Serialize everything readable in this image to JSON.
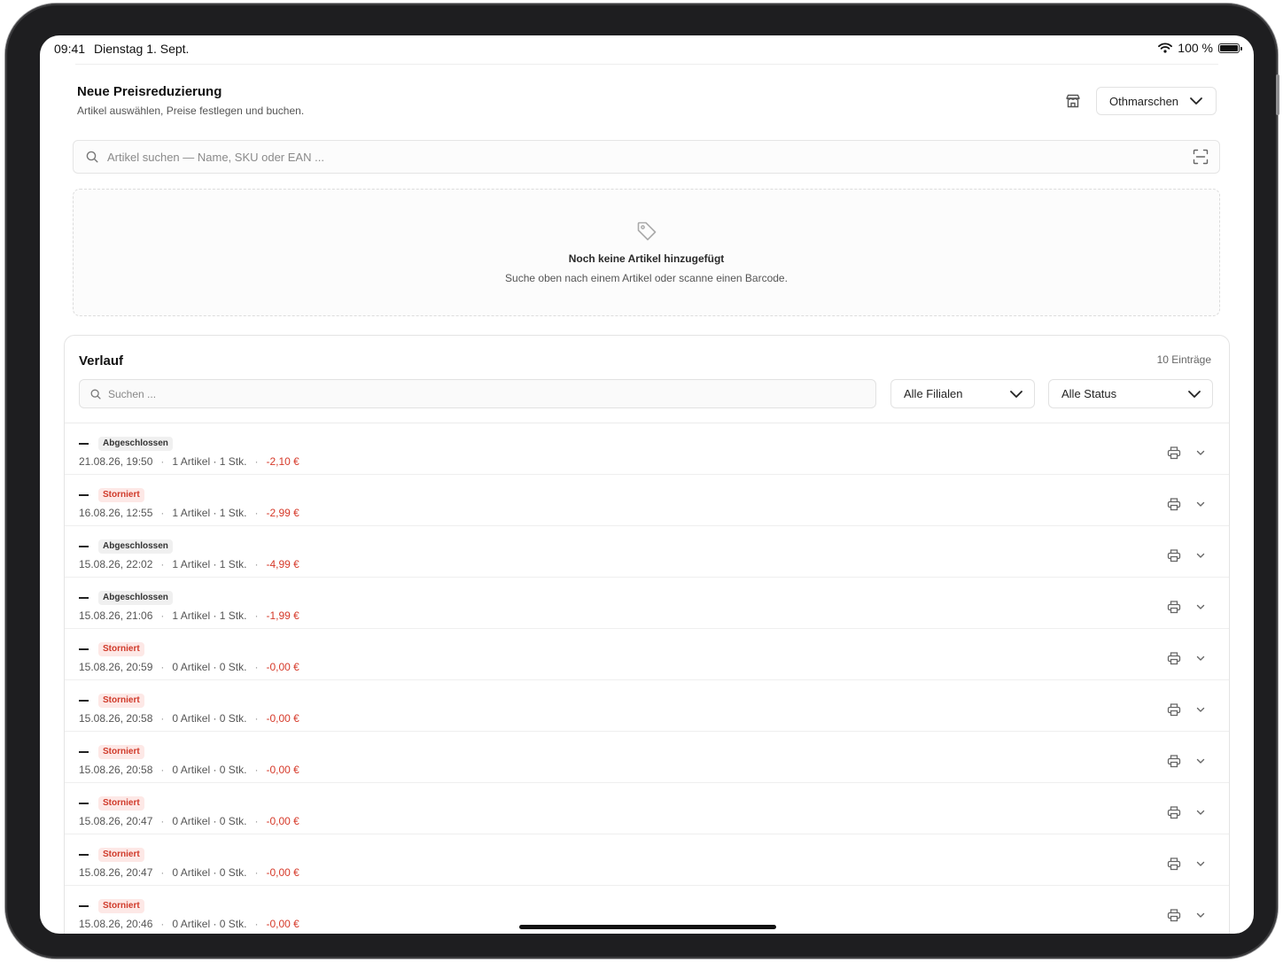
{
  "status_bar": {
    "time": "09:41",
    "date": "Dienstag 1. Sept.",
    "battery": "100 %",
    "battery_level": 1.0
  },
  "header": {
    "title": "Neue Preisreduzierung",
    "subtitle": "Artikel auswählen, Preise festlegen und buchen.",
    "store_icon": "store-icon",
    "branch": "Othmarschen"
  },
  "search": {
    "placeholder": "Artikel suchen — Name, SKU oder EAN ...",
    "value": ""
  },
  "empty_state": {
    "icon": "tag-icon",
    "title": "Noch keine Artikel hinzugefügt",
    "subtitle": "Suche oben nach einem Artikel oder scanne einen Barcode."
  },
  "history": {
    "title": "Verlauf",
    "count": "10 Einträge",
    "search_placeholder": "Suchen ...",
    "filter_branch": "Alle Filialen",
    "filter_status": "Alle Status",
    "rows": [
      {
        "status": "Abgeschlossen",
        "kind": "done",
        "datetime": "21.08.26, 19:50",
        "items": "1 Artikel · 1 Stk.",
        "amount": "-2,10 €"
      },
      {
        "status": "Storniert",
        "kind": "cancel",
        "datetime": "16.08.26, 12:55",
        "items": "1 Artikel · 1 Stk.",
        "amount": "-2,99 €"
      },
      {
        "status": "Abgeschlossen",
        "kind": "done",
        "datetime": "15.08.26, 22:02",
        "items": "1 Artikel · 1 Stk.",
        "amount": "-4,99 €"
      },
      {
        "status": "Abgeschlossen",
        "kind": "done",
        "datetime": "15.08.26, 21:06",
        "items": "1 Artikel · 1 Stk.",
        "amount": "-1,99 €"
      },
      {
        "status": "Storniert",
        "kind": "cancel",
        "datetime": "15.08.26, 20:59",
        "items": "0 Artikel · 0 Stk.",
        "amount": "-0,00 €"
      },
      {
        "status": "Storniert",
        "kind": "cancel",
        "datetime": "15.08.26, 20:58",
        "items": "0 Artikel · 0 Stk.",
        "amount": "-0,00 €"
      },
      {
        "status": "Storniert",
        "kind": "cancel",
        "datetime": "15.08.26, 20:58",
        "items": "0 Artikel · 0 Stk.",
        "amount": "-0,00 €"
      },
      {
        "status": "Storniert",
        "kind": "cancel",
        "datetime": "15.08.26, 20:47",
        "items": "0 Artikel · 0 Stk.",
        "amount": "-0,00 €"
      },
      {
        "status": "Storniert",
        "kind": "cancel",
        "datetime": "15.08.26, 20:47",
        "items": "0 Artikel · 0 Stk.",
        "amount": "-0,00 €"
      },
      {
        "status": "Storniert",
        "kind": "cancel",
        "datetime": "15.08.26, 20:46",
        "items": "0 Artikel · 0 Stk.",
        "amount": "-0,00 €"
      }
    ]
  },
  "colors": {
    "cancel_text": "#d03a2a",
    "cancel_bg": "#fde8e6",
    "amount": "#d63a2a",
    "done_bg": "#f0f0f0"
  }
}
